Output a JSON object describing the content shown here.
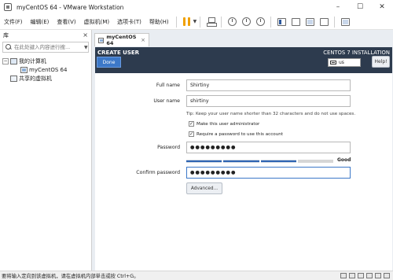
{
  "window": {
    "title": "myCentOS 64 - VMware Workstation",
    "minimize": "–",
    "maximize": "☐",
    "close": "✕"
  },
  "menu": {
    "items": [
      "文件(F)",
      "编辑(E)",
      "查看(V)",
      "虚拟机(M)",
      "选项卡(T)",
      "帮助(H)"
    ]
  },
  "library": {
    "title": "库",
    "close": "×",
    "search_placeholder": "在此处键入内容进行搜...",
    "tree": {
      "root_toggle": "−",
      "root": "我的计算机",
      "vm": "myCentOS 64",
      "shared": "共享的虚拟机"
    }
  },
  "tab": {
    "label": "myCentOS 64",
    "close": "×"
  },
  "installer": {
    "page_title": "CREATE USER",
    "done": "Done",
    "product": "CENTOS 7 INSTALLATION",
    "keyboard": "us",
    "help": "Help!",
    "labels": {
      "full_name": "Full name",
      "user_name": "User name",
      "password": "Password",
      "confirm": "Confirm password"
    },
    "values": {
      "full_name": "Shirtiny",
      "user_name": "shirtiny",
      "password": "●●●●●●●●●",
      "confirm": "●●●●●●●●●"
    },
    "tip": "Tip: Keep your user name shorter than 32 characters and do not use spaces.",
    "make_admin": "Make this user administrator",
    "require_password": "Require a password to use this account",
    "check_mark": "✓",
    "strength_label": "Good",
    "strength_level": 0.75,
    "advanced": "Advanced..."
  },
  "status": {
    "message": "要将输入定向到该虚拟机，请在虚拟机内部单击或按 Ctrl+G。"
  }
}
